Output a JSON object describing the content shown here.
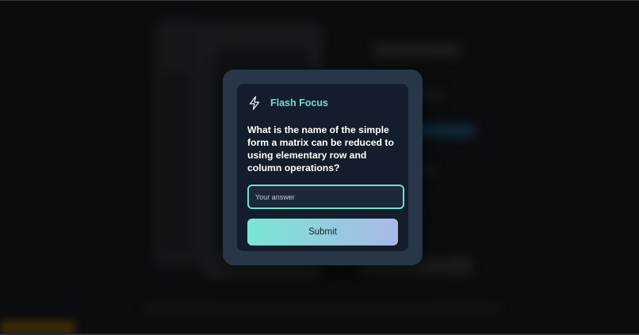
{
  "modal": {
    "brand": "Flash Focus",
    "brand_icon": "lightning-bolt-icon",
    "question": "What is the name of the simple form a matrix can be reduced to using elementary row and column operations?",
    "answer_placeholder": "Your answer",
    "answer_value": "",
    "submit_label": "Submit"
  },
  "colors": {
    "accent": "#6fe0cd",
    "button_gradient_start": "#79e6d3",
    "button_gradient_end": "#aab8e8",
    "card_bg": "#141d2b",
    "frame_bg": "#283748"
  }
}
